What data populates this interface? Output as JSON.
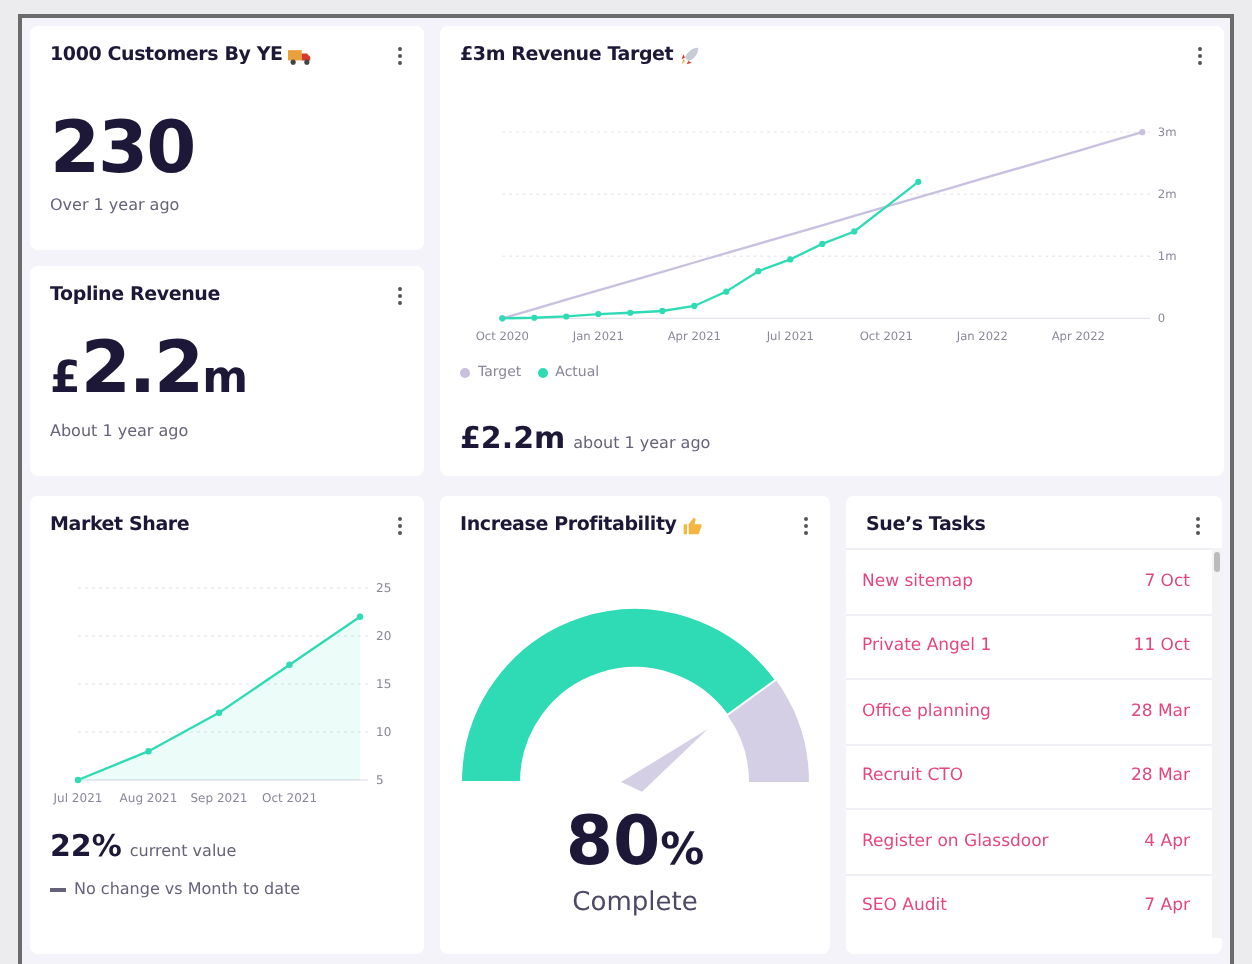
{
  "cards": [
    {
      "kind": "stat",
      "title": "1000 Customers By YE",
      "value": "230",
      "caption": "Over 1 year ago"
    },
    {
      "kind": "money",
      "title": "Topline Revenue",
      "prefix": "£",
      "value": "2.2",
      "suffix": "m",
      "caption": "About 1 year ago"
    },
    {
      "kind": "chart",
      "title": "£3m Revenue Target",
      "chart_data": {
        "type": "line",
        "grid": true,
        "ylim": [
          0,
          3
        ],
        "categories": [
          "Oct 2020",
          null,
          null,
          "Jan 2021",
          null,
          null,
          "Apr 2021",
          null,
          null,
          "Jul 2021",
          null,
          null,
          "Oct 2021",
          null,
          null,
          "Jan 2022",
          null,
          null,
          "Apr 2022",
          null,
          null
        ],
        "yticks": [
          {
            "value": 0,
            "label": "0"
          },
          {
            "value": 1,
            "label": "1m"
          },
          {
            "value": 2,
            "label": "2m"
          },
          {
            "value": 3,
            "label": "3m"
          }
        ],
        "series": [
          {
            "name": "Target",
            "color": "#c9c0e0",
            "values": [
              0,
              0.15,
              0.3,
              0.45,
              0.6,
              0.75,
              0.9,
              1.05,
              1.2,
              1.35,
              1.5,
              1.65,
              1.8,
              1.95,
              2.1,
              2.25,
              2.4,
              2.55,
              2.7,
              2.85,
              3
            ]
          },
          {
            "name": "Actual",
            "color": "#2fdbb4",
            "marker": true,
            "values": [
              0,
              0.01,
              0.03,
              0.07,
              0.09,
              0.12,
              0.2,
              0.43,
              0.76,
              0.95,
              1.2,
              1.4,
              null,
              2.2,
              null,
              null,
              null,
              null,
              null,
              null,
              null
            ]
          }
        ]
      },
      "headline": "£2.2m",
      "caption": "about 1 year ago"
    },
    {
      "kind": "trend",
      "title": "Market Share",
      "chart_data": {
        "type": "area",
        "grid": true,
        "ylim": [
          5,
          25
        ],
        "categories": [
          "Jul 2021",
          "Aug 2021",
          "Sep 2021",
          "Oct 2021",
          null
        ],
        "yticks": [
          5,
          10,
          15,
          20,
          25
        ],
        "series": [
          {
            "color": "#2fdbb4",
            "marker": true,
            "values": [
              5,
              8,
              12,
              17,
              22
            ]
          }
        ]
      },
      "headline": "22%",
      "caption": "current value",
      "change": "No change vs Month to date"
    },
    {
      "kind": "gauge",
      "title": "Increase Profitability",
      "value": "80",
      "unit": "%",
      "caption": "Complete"
    },
    {
      "kind": "tasks",
      "title": "Sue’s Tasks",
      "tasks": [
        {
          "name": "New sitemap",
          "due": "7 Oct"
        },
        {
          "name": "Private Angel 1",
          "due": "11 Oct"
        },
        {
          "name": "Office planning",
          "due": "28 Mar"
        },
        {
          "name": "Recruit CTO",
          "due": "28 Mar"
        },
        {
          "name": "Register on Glassdoor",
          "due": "4 Apr"
        },
        {
          "name": "SEO Audit",
          "due": "7 Apr"
        }
      ]
    }
  ]
}
